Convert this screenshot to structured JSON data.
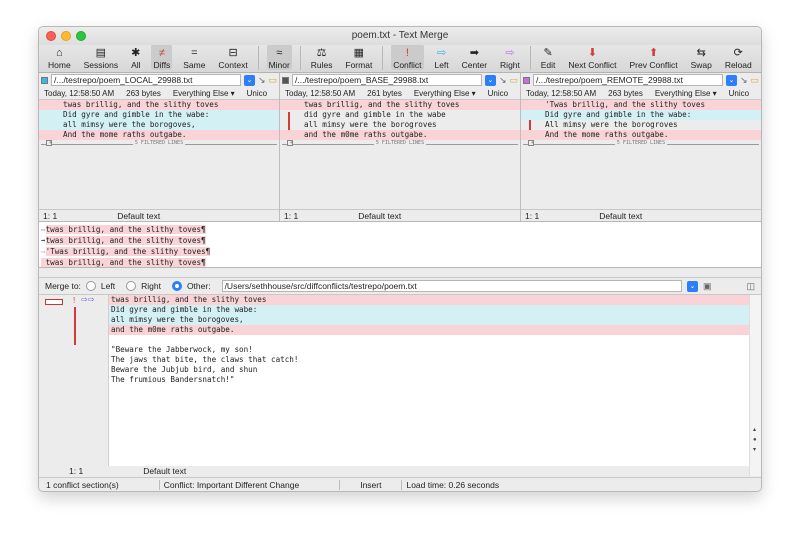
{
  "window": {
    "title": "poem.txt - Text Merge"
  },
  "toolbar": [
    {
      "icon": "⌂",
      "label": "Home"
    },
    {
      "icon": "▤",
      "label": "Sessions"
    },
    {
      "icon": "✱",
      "label": "All"
    },
    {
      "icon": "≠",
      "label": "Diffs",
      "active": true
    },
    {
      "icon": "=",
      "label": "Same"
    },
    {
      "icon": "⊟",
      "label": "Context"
    },
    {
      "icon": "≈",
      "label": "Minor",
      "active": true
    },
    {
      "icon": "⚖",
      "label": "Rules"
    },
    {
      "icon": "▦",
      "label": "Format"
    },
    {
      "icon": "!",
      "label": "Conflict",
      "active": true
    },
    {
      "icon": "⇨",
      "label": "Left"
    },
    {
      "icon": "➡",
      "label": "Center"
    },
    {
      "icon": "⇨",
      "label": "Right"
    },
    {
      "icon": "✎",
      "label": "Edit"
    },
    {
      "icon": "⬇",
      "label": "Next Conflict"
    },
    {
      "icon": "⬆",
      "label": "Prev Conflict"
    },
    {
      "icon": "⇆",
      "label": "Swap"
    },
    {
      "icon": "⟳",
      "label": "Reload"
    }
  ],
  "panes": [
    {
      "path": "/.../testrepo/poem_LOCAL_29988.txt",
      "color": "#38b8e6",
      "timestamp": "Today, 12:58:50 AM",
      "size": "263 bytes",
      "filter": "Everything Else",
      "encoding": "Unico",
      "lines": [
        "twas brillig, and the slithy toves",
        "Did gyre and gimble in the wabe:",
        "all mimsy were the borogoves,",
        "And the mome raths outgabe."
      ],
      "line_colors": [
        "pink",
        "cyan",
        "cyan",
        "pink"
      ],
      "filtered": "5 FILTERED LINES",
      "pos": "1: 1",
      "format": "Default text"
    },
    {
      "path": "/.../testrepo/poem_BASE_29988.txt",
      "color": "#555555",
      "timestamp": "Today, 12:58:50 AM",
      "size": "261 bytes",
      "filter": "Everything Else",
      "encoding": "Unico",
      "lines": [
        "twas brillig, and the slithy toves",
        "did gyre and gimble in the wabe",
        "all mimsy were the borogroves",
        "and the m0me raths outgabe."
      ],
      "line_colors": [
        "pink",
        "",
        "",
        "pink"
      ],
      "filtered": "5 FILTERED LINES",
      "pos": "1: 1",
      "format": "Default text"
    },
    {
      "path": "/.../testrepo/poem_REMOTE_29988.txt",
      "color": "#c46fe0",
      "timestamp": "Today, 12:58:50 AM",
      "size": "263 bytes",
      "filter": "Everything Else",
      "encoding": "Unico",
      "lines": [
        "'Twas brillig, and the slithy toves",
        "Did gyre and gimble in the wabe:",
        "All mimsy were the borogroves",
        "And the mome raths outgabe."
      ],
      "line_colors": [
        "pink",
        "cyan",
        "",
        "pink"
      ],
      "filtered": "5 FILTERED LINES",
      "pos": "1: 1",
      "format": "Default text"
    }
  ],
  "summary": [
    {
      "arrow": "⇨",
      "text": "twas brillig, and the slithy toves¶"
    },
    {
      "arrow": "➡",
      "text": "twas brillig, and the slithy toves¶"
    },
    {
      "arrow": "⇨",
      "text": "'Twas brillig, and the slithy toves¶"
    },
    {
      "arrow": "",
      "text": " twas brillig, and the slithy toves¶"
    }
  ],
  "merge": {
    "label": "Merge to:",
    "options": [
      "Left",
      "Right",
      "Other:"
    ],
    "selected": "Other:",
    "path": "/Users/sethhouse/src/diffconflicts/testrepo/poem.txt",
    "lines": [
      "twas brillig, and the slithy toves",
      "Did gyre and gimble in the wabe:",
      "all mimsy were the borogoves,",
      "and the m0me raths outgabe.",
      "",
      "\"Beware the Jabberwock, my son!",
      "The jaws that bite, the claws that catch!",
      "Beware the Jubjub bird, and shun",
      "The frumious Bandersnatch!\""
    ],
    "line_colors": [
      "pink",
      "cyan",
      "cyan",
      "pink",
      "",
      "",
      "",
      "",
      ""
    ],
    "pos": "1: 1",
    "format": "Default text"
  },
  "status": {
    "conflicts": "1 conflict section(s)",
    "conflict_type": "Conflict: Important Different Change",
    "mode": "Insert",
    "load_time": "Load time: 0.26 seconds"
  }
}
